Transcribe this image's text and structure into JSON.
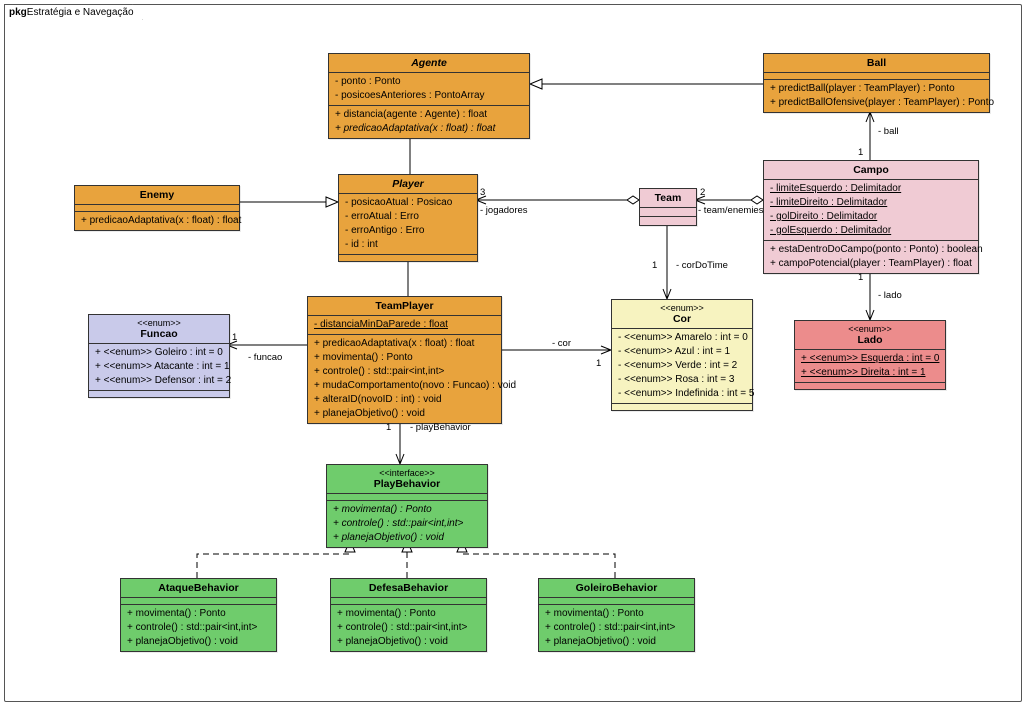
{
  "package": {
    "prefix": "pkg",
    "title": "Estratégia e Navegação"
  },
  "classes": {
    "agente": {
      "name": "Agente",
      "stereo": "",
      "italic": true,
      "attrs": [
        {
          "text": "- ponto : Ponto"
        },
        {
          "text": "- posicoesAnteriores : PontoArray"
        }
      ],
      "ops": [
        {
          "text": "+ distancia(agente : Agente) : float"
        },
        {
          "text": "+ predicaoAdaptativa(x : float) : float",
          "italic": true
        }
      ]
    },
    "ball": {
      "name": "Ball",
      "stereo": "",
      "attrs": [],
      "ops": [
        {
          "text": "+ predictBall(player : TeamPlayer) : Ponto"
        },
        {
          "text": "+ predictBallOfensive(player : TeamPlayer) : Ponto"
        }
      ]
    },
    "enemy": {
      "name": "Enemy",
      "stereo": "",
      "attrs": [],
      "ops": [
        {
          "text": "+ predicaoAdaptativa(x : float) : float"
        }
      ]
    },
    "player": {
      "name": "Player",
      "stereo": "",
      "italic": true,
      "attrs": [
        {
          "text": "- posicaoAtual : Posicao"
        },
        {
          "text": "- erroAtual : Erro"
        },
        {
          "text": "- erroAntigo : Erro"
        },
        {
          "text": "- id : int"
        }
      ],
      "ops": []
    },
    "team": {
      "name": "Team",
      "stereo": "",
      "attrs": [],
      "ops": []
    },
    "campo": {
      "name": "Campo",
      "stereo": "",
      "attrs": [
        {
          "text": "- limiteEsquerdo : Delimitador",
          "uline": true
        },
        {
          "text": "- limiteDireito : Delimitador",
          "uline": true
        },
        {
          "text": "- golDireito : Delimitador",
          "uline": true
        },
        {
          "text": "- golEsquerdo : Delimitador",
          "uline": true
        }
      ],
      "ops": [
        {
          "text": "+ estaDentroDoCampo(ponto : Ponto) : boolean"
        },
        {
          "text": "+ campoPotencial(player : TeamPlayer) : float"
        }
      ]
    },
    "teamplayer": {
      "name": "TeamPlayer",
      "stereo": "",
      "attrs": [
        {
          "text": "- distanciaMinDaParede : float",
          "uline": true
        }
      ],
      "ops": [
        {
          "text": "+ predicaoAdaptativa(x : float) : float"
        },
        {
          "text": "+ movimenta() : Ponto"
        },
        {
          "text": "+ controle() : std::pair<int,int>"
        },
        {
          "text": "+ mudaComportamento(novo : Funcao) : void"
        },
        {
          "text": "+ alteraID(novoID : int) : void"
        },
        {
          "text": "+ planejaObjetivo() : void"
        }
      ]
    },
    "funcao": {
      "name": "Funcao",
      "stereo": "<<enum>>",
      "attrs": [
        {
          "text": "+ <<enum>> Goleiro : int = 0"
        },
        {
          "text": "+ <<enum>> Atacante : int = 1"
        },
        {
          "text": "+ <<enum>> Defensor : int = 2"
        }
      ],
      "ops": []
    },
    "cor": {
      "name": "Cor",
      "stereo": "<<enum>>",
      "attrs": [
        {
          "text": "- <<enum>> Amarelo : int = 0"
        },
        {
          "text": "- <<enum>> Azul : int = 1"
        },
        {
          "text": "- <<enum>> Verde : int = 2"
        },
        {
          "text": "- <<enum>> Rosa : int = 3"
        },
        {
          "text": "- <<enum>> Indefinida : int = 5"
        }
      ],
      "ops": []
    },
    "lado": {
      "name": "Lado",
      "stereo": "<<enum>>",
      "attrs": [
        {
          "text": "+ <<enum>> Esquerda : int = 0",
          "uline": true
        },
        {
          "text": "+ <<enum>> Direita : int = 1",
          "uline": true
        }
      ],
      "ops": []
    },
    "playbehavior": {
      "name": "PlayBehavior",
      "stereo": "<<interface>>",
      "attrs": [],
      "ops": [
        {
          "text": "+ movimenta() : Ponto",
          "italic": true
        },
        {
          "text": "+ controle() : std::pair<int,int>",
          "italic": true
        },
        {
          "text": "+ planejaObjetivo() : void",
          "italic": true
        }
      ]
    },
    "ataque": {
      "name": "AtaqueBehavior",
      "stereo": "",
      "attrs": [],
      "ops": [
        {
          "text": "+ movimenta() : Ponto"
        },
        {
          "text": "+ controle() : std::pair<int,int>"
        },
        {
          "text": "+ planejaObjetivo() : void"
        }
      ]
    },
    "defesa": {
      "name": "DefesaBehavior",
      "stereo": "",
      "attrs": [],
      "ops": [
        {
          "text": "+ movimenta() : Ponto"
        },
        {
          "text": "+ controle() : std::pair<int,int>"
        },
        {
          "text": "+ planejaObjetivo() : void"
        }
      ]
    },
    "goleiro": {
      "name": "GoleiroBehavior",
      "stereo": "",
      "attrs": [],
      "ops": [
        {
          "text": "+ movimenta() : Ponto"
        },
        {
          "text": "+ controle() : std::pair<int,int>"
        },
        {
          "text": "+ planejaObjetivo() : void"
        }
      ]
    }
  },
  "labels": {
    "jogadores": "- jogadores",
    "three": "3",
    "teamenemies": "- team/enemies",
    "two": "2",
    "ballrole": "- ball",
    "one1": "1",
    "one1b": "1",
    "lado": "- lado",
    "one1c": "1",
    "cordotime": "- corDoTime",
    "one1d": "1",
    "cor": "- cor",
    "one1e": "1",
    "funcao": "- funcao",
    "one1f": "1",
    "playbehavior": "- playBehavior",
    "one1g": "1"
  },
  "colors": {
    "orange": "#e8a33d",
    "orangeDark": "#d18e20",
    "pink": "#f0cbd4",
    "red": "#ec8c8c",
    "lav": "#c9caea",
    "yellow": "#f7f3c0",
    "green": "#6fcc6c"
  }
}
